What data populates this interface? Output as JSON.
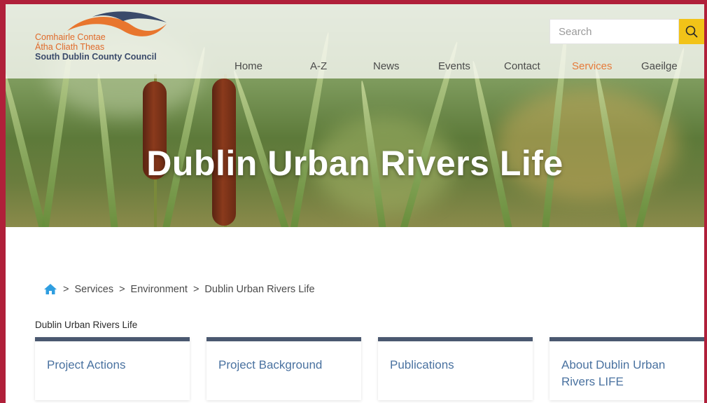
{
  "logo": {
    "line1": "Comhairle Contae",
    "line2": "Átha Cliath Theas",
    "line3": "South Dublin County Council"
  },
  "search": {
    "placeholder": "Search"
  },
  "nav": [
    "Home",
    "A-Z",
    "News",
    "Events",
    "Contact",
    "Services",
    "Gaeilge"
  ],
  "nav_active": "Services",
  "hero": {
    "title": "Dublin Urban Rivers Life"
  },
  "breadcrumb": {
    "items": [
      "Services",
      "Environment",
      "Dublin Urban Rivers Life"
    ],
    "separator": ">"
  },
  "page_label": "Dublin Urban Rivers Life",
  "cards": [
    "Project Actions",
    "Project Background",
    "Publications",
    "About Dublin Urban Rivers LIFE"
  ],
  "colors": {
    "frame": "#b0203a",
    "accent_orange": "#e67a3a",
    "search_button": "#f2c318",
    "card_top": "#4a5870",
    "link_blue": "#4a72a0",
    "home_icon": "#2f9ee0"
  },
  "icons": {
    "search": "magnifier-icon",
    "home": "house-icon"
  }
}
